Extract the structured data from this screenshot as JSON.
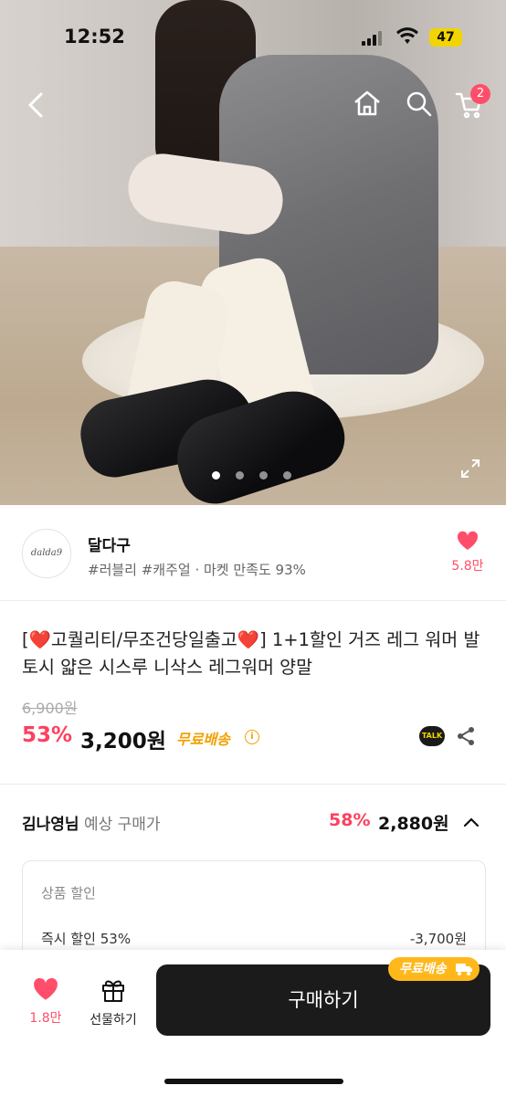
{
  "status_bar": {
    "time": "12:52",
    "battery": "47"
  },
  "top_nav": {
    "cart_count": "2"
  },
  "carousel": {
    "count": 4,
    "active": 0
  },
  "seller": {
    "logo_text": "dalda9",
    "name": "달다구",
    "tags": "#러블리 #캐주얼 · 마켓 만족도 93%",
    "like_count": "5.8만"
  },
  "product": {
    "title": "[❤️고퀄리티/무조건당일출고❤️] 1+1할인 거즈 레그 워머 발토시 얇은 시스루 니삭스 레그워머 양말",
    "original_price": "6,900원",
    "discount_rate": "53%",
    "price": "3,200원",
    "shipping": "무료배송",
    "talk_label": "TALK"
  },
  "member": {
    "name": "김나영님",
    "label": "예상 구매가",
    "discount_rate": "58%",
    "price": "2,880원"
  },
  "discount_detail": {
    "header": "상품 할인",
    "row_label": "즉시 할인 53%",
    "row_value": "-3,700원"
  },
  "bottom_bar": {
    "like_count": "1.8만",
    "gift_label": "선물하기",
    "buy_label": "구매하기",
    "buy_badge": "무료배송"
  },
  "colors": {
    "accent": "#ff3f5f",
    "shipping": "#f2a100",
    "buy_button": "#1b1b1b"
  }
}
